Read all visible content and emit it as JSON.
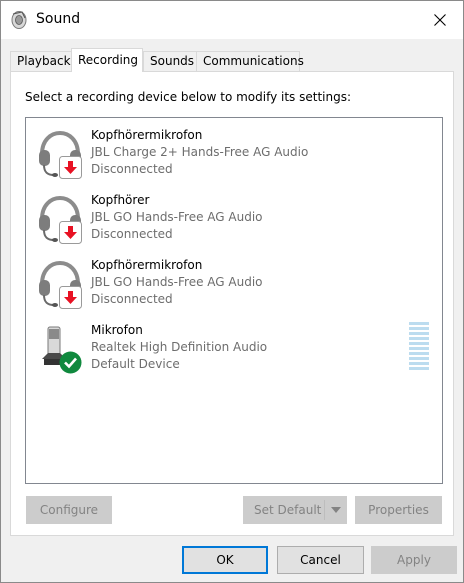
{
  "window": {
    "title": "Sound"
  },
  "tabs": [
    {
      "label": "Playback"
    },
    {
      "label": "Recording"
    },
    {
      "label": "Sounds"
    },
    {
      "label": "Communications"
    }
  ],
  "panel": {
    "instruction": "Select a recording device below to modify its settings:"
  },
  "devices": [
    {
      "name": "Kopfhörermikrofon",
      "description": "JBL Charge 2+ Hands-Free AG Audio",
      "status": "Disconnected",
      "icon": "headset-icon",
      "badge": "red-down-arrow"
    },
    {
      "name": "Kopfhörer",
      "description": "JBL GO Hands-Free AG Audio",
      "status": "Disconnected",
      "icon": "headset-icon",
      "badge": "red-down-arrow"
    },
    {
      "name": "Kopfhörermikrofon",
      "description": "JBL GO Hands-Free AG Audio",
      "status": "Disconnected",
      "icon": "headset-icon",
      "badge": "red-down-arrow"
    },
    {
      "name": "Mikrofon",
      "description": "Realtek High Definition Audio",
      "status": "Default Device",
      "icon": "microphone-icon",
      "badge": "green-check"
    }
  ],
  "buttons": {
    "configure": "Configure",
    "set_default": "Set Default",
    "properties": "Properties",
    "ok": "OK",
    "cancel": "Cancel",
    "apply": "Apply"
  },
  "colors": {
    "accent": "#0078d7",
    "disconnected_badge": "#e81123",
    "default_badge": "#10893e",
    "level_meter": "#bcdcef"
  }
}
